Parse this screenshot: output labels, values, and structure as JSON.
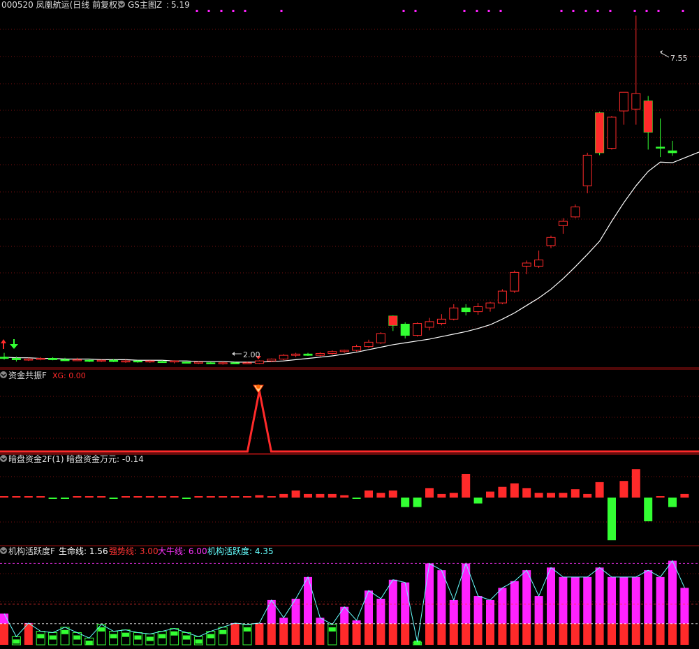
{
  "main": {
    "title": "000520 凤凰航运(日线 前复权)",
    "indicator_name": "GS主图Z",
    "indicator_value": "5.19",
    "high_label": "7.55",
    "low_label": "2.00"
  },
  "sub1": {
    "name": "资金共振F",
    "line_label": "XG: 0.00"
  },
  "sub2": {
    "name": "暗盘资金2F(1)",
    "line_label": "暗盘资金万元: -0.14"
  },
  "sub3": {
    "name": "机构活跃度F",
    "labels": [
      {
        "text": "生命线: 1.56",
        "color": "#ffffff"
      },
      {
        "text": "强势线: 3.00",
        "color": "#ff3333"
      },
      {
        "text": "大牛线: 6.00",
        "color": "#ff33ff"
      },
      {
        "text": "机构活跃度: 4.35",
        "color": "#66ffff"
      }
    ]
  },
  "colors": {
    "up": "#ff2a2a",
    "down": "#33ff33",
    "ma": "#ffffff",
    "grid": "#7a1010",
    "separator": "#a01010",
    "magenta": "#ff22ff",
    "cyan": "#66ffff"
  },
  "chart_data": [
    {
      "type": "candlestick",
      "ylim": [
        1.9,
        7.8
      ],
      "candles": [
        [
          2.07,
          2.14,
          2.03,
          2.05
        ],
        [
          2.05,
          2.08,
          2.0,
          2.03
        ],
        [
          2.03,
          2.06,
          2.01,
          2.04
        ],
        [
          2.04,
          2.07,
          2.02,
          2.05
        ],
        [
          2.05,
          2.07,
          2.02,
          2.03
        ],
        [
          2.03,
          2.06,
          2.01,
          2.02
        ],
        [
          2.03,
          2.06,
          2.01,
          2.03
        ],
        [
          2.02,
          2.04,
          1.99,
          2.01
        ],
        [
          2.01,
          2.03,
          1.99,
          2.02
        ],
        [
          2.02,
          2.04,
          1.99,
          2.0
        ],
        [
          2.0,
          2.03,
          1.98,
          2.01
        ],
        [
          2.01,
          2.02,
          1.98,
          2.0
        ],
        [
          2.0,
          2.02,
          1.98,
          2.01
        ],
        [
          2.0,
          2.02,
          1.98,
          1.99
        ],
        [
          2.0,
          2.02,
          1.97,
          2.01
        ],
        [
          1.99,
          2.01,
          1.97,
          1.98
        ],
        [
          1.98,
          2.0,
          1.96,
          1.99
        ],
        [
          1.98,
          2.0,
          1.96,
          1.97
        ],
        [
          1.97,
          2.0,
          1.95,
          1.98
        ],
        [
          1.98,
          2.0,
          1.96,
          1.97
        ],
        [
          1.97,
          2.0,
          1.96,
          1.98
        ],
        [
          1.97,
          2.02,
          1.96,
          2.01
        ],
        [
          2.01,
          2.05,
          1.99,
          2.04
        ],
        [
          2.04,
          2.12,
          2.02,
          2.1
        ],
        [
          2.1,
          2.14,
          2.07,
          2.12
        ],
        [
          2.12,
          2.14,
          2.09,
          2.1
        ],
        [
          2.1,
          2.15,
          2.08,
          2.13
        ],
        [
          2.13,
          2.18,
          2.11,
          2.16
        ],
        [
          2.16,
          2.19,
          2.14,
          2.18
        ],
        [
          2.18,
          2.27,
          2.16,
          2.24
        ],
        [
          2.24,
          2.35,
          2.22,
          2.31
        ],
        [
          2.3,
          2.47,
          2.28,
          2.45
        ],
        [
          2.73,
          2.74,
          2.49,
          2.58
        ],
        [
          2.6,
          2.63,
          2.37,
          2.42
        ],
        [
          2.42,
          2.63,
          2.4,
          2.61
        ],
        [
          2.55,
          2.7,
          2.5,
          2.64
        ],
        [
          2.61,
          2.76,
          2.58,
          2.68
        ],
        [
          2.68,
          2.92,
          2.66,
          2.86
        ],
        [
          2.86,
          2.92,
          2.74,
          2.8
        ],
        [
          2.8,
          2.94,
          2.75,
          2.88
        ],
        [
          2.86,
          2.96,
          2.8,
          2.94
        ],
        [
          2.94,
          3.16,
          2.92,
          3.13
        ],
        [
          3.13,
          3.46,
          3.1,
          3.43
        ],
        [
          3.53,
          3.62,
          3.4,
          3.58
        ],
        [
          3.53,
          3.78,
          3.5,
          3.63
        ],
        [
          3.86,
          4.02,
          3.82,
          3.99
        ],
        [
          4.18,
          4.3,
          4.05,
          4.25
        ],
        [
          4.32,
          4.52,
          4.3,
          4.48
        ],
        [
          4.82,
          5.35,
          4.7,
          5.31
        ],
        [
          5.99,
          6.01,
          5.31,
          5.35
        ],
        [
          5.42,
          5.94,
          5.4,
          5.92
        ],
        [
          6.02,
          6.32,
          5.8,
          6.32
        ],
        [
          6.05,
          7.55,
          5.8,
          6.3
        ],
        [
          6.18,
          6.26,
          5.4,
          5.68
        ],
        [
          5.44,
          5.9,
          5.28,
          5.43
        ],
        [
          5.38,
          5.54,
          5.3,
          5.35
        ]
      ],
      "ma": [
        2.07,
        2.06,
        2.06,
        2.05,
        2.05,
        2.04,
        2.04,
        2.04,
        2.03,
        2.03,
        2.03,
        2.02,
        2.02,
        2.02,
        2.01,
        2.01,
        2.0,
        2.0,
        2.0,
        1.99,
        1.99,
        1.99,
        2.0,
        2.01,
        2.03,
        2.05,
        2.07,
        2.09,
        2.12,
        2.15,
        2.19,
        2.23,
        2.27,
        2.3,
        2.33,
        2.36,
        2.4,
        2.44,
        2.48,
        2.53,
        2.59,
        2.68,
        2.78,
        2.9,
        3.02,
        3.16,
        3.33,
        3.52,
        3.72,
        3.93,
        4.25,
        4.55,
        4.82,
        5.05,
        5.2,
        5.19
      ]
    },
    {
      "type": "line",
      "name": "XG",
      "ylim": [
        0,
        1
      ],
      "values": [
        0,
        0,
        0,
        0,
        0,
        0,
        0,
        0,
        0,
        0,
        0,
        0,
        0,
        0,
        0,
        0,
        0,
        0,
        0,
        0,
        0,
        1,
        0,
        0,
        0,
        0,
        0,
        0,
        0,
        0,
        0,
        0,
        0,
        0,
        0,
        0,
        0,
        0,
        0,
        0,
        0,
        0,
        0,
        0,
        0,
        0,
        0,
        0,
        0,
        0,
        0,
        0,
        0,
        0,
        0,
        0,
        0
      ]
    },
    {
      "type": "bar",
      "name": "暗盘资金万元",
      "ylim": [
        -4,
        2
      ],
      "values": [
        0.1,
        0.1,
        0.1,
        0.1,
        -0.1,
        -0.1,
        0.1,
        0.1,
        0.1,
        -0.1,
        0.1,
        0.1,
        0.1,
        0.1,
        0.1,
        -0.1,
        0.1,
        0.1,
        0.1,
        0.1,
        0.1,
        0.2,
        0.1,
        0.3,
        0.6,
        0.3,
        0.3,
        0.3,
        0.2,
        -0.1,
        0.6,
        0.4,
        0.6,
        -0.8,
        -0.8,
        0.8,
        0.3,
        0.4,
        2.0,
        -0.5,
        0.5,
        0.9,
        1.2,
        0.8,
        0.4,
        0.4,
        0.4,
        0.7,
        0.3,
        1.3,
        -3.6,
        1.4,
        2.4,
        -2.0,
        0.1,
        -0.8,
        0.3
      ]
    },
    {
      "type": "bar",
      "name": "机构活跃度",
      "ylim": [
        0,
        7
      ],
      "values": [
        2.3,
        0.6,
        1.6,
        1.0,
        0.9,
        1.3,
        0.9,
        0.5,
        1.5,
        1.0,
        1.1,
        0.9,
        0.8,
        1.0,
        1.2,
        0.9,
        0.6,
        1.0,
        1.3,
        1.6,
        1.5,
        1.6,
        3.3,
        2.0,
        3.4,
        5.0,
        2.0,
        1.5,
        2.8,
        1.8,
        4.0,
        3.4,
        4.8,
        4.6,
        0.2,
        6.0,
        5.5,
        3.3,
        6.0,
        3.6,
        3.3,
        4.2,
        4.7,
        5.5,
        3.6,
        5.7,
        5.0,
        5.0,
        5.0,
        5.7,
        5.0,
        5.0,
        5.0,
        5.5,
        5.0,
        6.2,
        4.2
      ],
      "line": [
        2.3,
        0.6,
        1.6,
        1.0,
        0.9,
        1.3,
        0.9,
        0.5,
        1.5,
        1.0,
        1.1,
        0.9,
        0.8,
        1.0,
        1.2,
        0.9,
        0.6,
        1.0,
        1.3,
        1.6,
        1.5,
        1.6,
        3.3,
        2.0,
        3.4,
        5.0,
        2.0,
        1.5,
        2.8,
        1.8,
        4.0,
        3.4,
        4.8,
        4.6,
        0.2,
        6.0,
        5.5,
        3.3,
        6.0,
        3.6,
        3.3,
        4.2,
        4.7,
        5.5,
        3.6,
        5.7,
        5.0,
        5.0,
        5.0,
        5.7,
        5.0,
        5.0,
        5.0,
        5.5,
        5.0,
        6.2,
        4.2
      ],
      "levels": [
        1.56,
        3.0,
        6.0
      ]
    }
  ]
}
